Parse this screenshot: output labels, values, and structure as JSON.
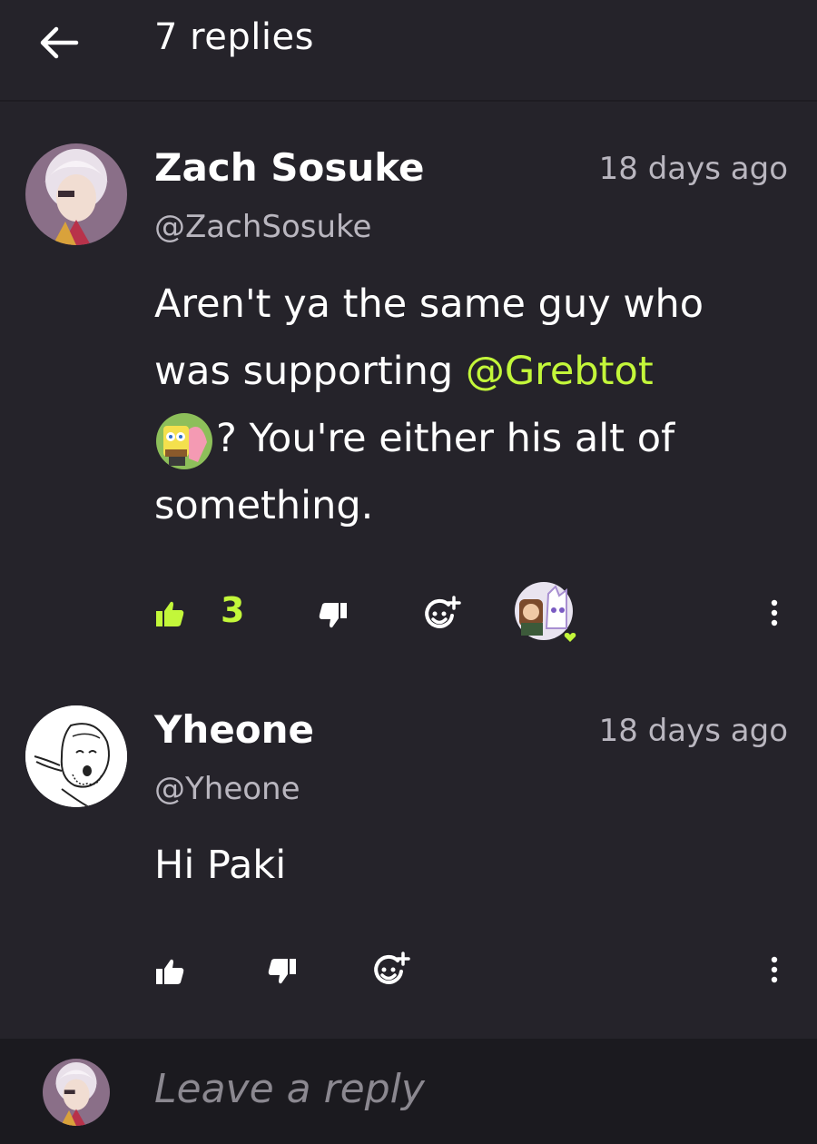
{
  "header": {
    "title": "7 replies"
  },
  "comments": [
    {
      "username": "Zach Sosuke",
      "handle": "@ZachSosuke",
      "timestamp": "18 days ago",
      "text_part1": "Aren't ya the same guy who was supporting ",
      "mention": "@Grebtot",
      "text_part2": "? You're either his alt of something.",
      "likes": "3"
    },
    {
      "username": "Yheone",
      "handle": "@Yheone",
      "timestamp": "18 days ago",
      "text": "Hi Paki"
    }
  ],
  "reply": {
    "placeholder": "Leave a reply"
  },
  "colors": {
    "accent": "#c3f73a",
    "background": "#25232a",
    "muted": "#b9b6bf"
  }
}
